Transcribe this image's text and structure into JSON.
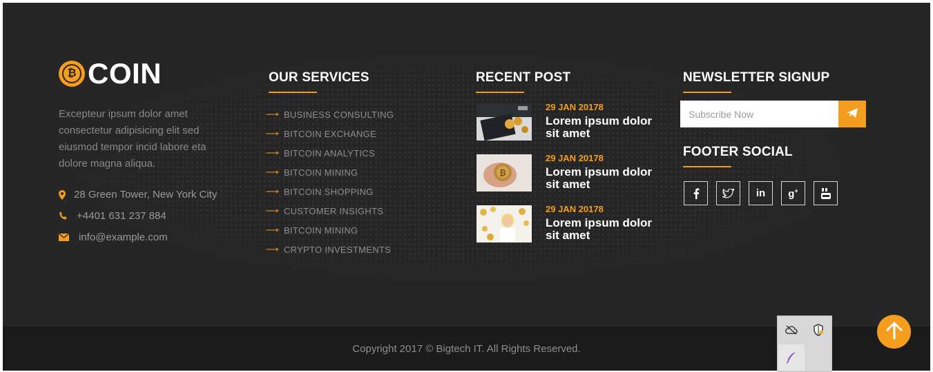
{
  "brand": {
    "logo_letter": "₿",
    "logo_text": "COIN",
    "about": "Excepteur ipsum dolor amet consectetur adipisicing elit sed eiusmod tempor incid labore eta dolore magna aliqua.",
    "contacts": [
      {
        "icon": "map-marker-icon",
        "text": "28 Green Tower, New York City"
      },
      {
        "icon": "phone-icon",
        "text": "+4401 631 237 884"
      },
      {
        "icon": "envelope-icon",
        "text": "info@example.com"
      }
    ]
  },
  "services": {
    "heading": "OUR SERVICES",
    "items": [
      "BUSINESS CONSULTING",
      "BITCOIN EXCHANGE",
      "BITCOIN ANALYTICS",
      "BITCOIN MINING",
      "BITCOIN SHOPPING",
      "CUSTOMER INSIGHTS",
      "BITCOIN MINING",
      "CRYPTO INVESTMENTS"
    ]
  },
  "recent_post": {
    "heading": "RECENT POST",
    "posts": [
      {
        "date": "29 JAN 20178",
        "title": "Lorem ipsum dolor sit amet"
      },
      {
        "date": "29 JAN 20178",
        "title": "Lorem ipsum dolor sit amet"
      },
      {
        "date": "29 JAN 20178",
        "title": "Lorem ipsum dolor sit amet"
      }
    ]
  },
  "newsletter": {
    "heading": "NEWSLETTER SIGNUP",
    "placeholder": "Subscribe Now",
    "button_icon": "paper-plane-icon"
  },
  "social": {
    "heading": "FOOTER SOCIAL",
    "items": [
      {
        "icon": "facebook-icon",
        "glyph": "f"
      },
      {
        "icon": "twitter-icon",
        "glyph": "🐦"
      },
      {
        "icon": "linkedin-icon",
        "glyph": "in"
      },
      {
        "icon": "google-plus-icon",
        "glyph": "g+"
      },
      {
        "icon": "youtube-icon",
        "glyph": "▶"
      }
    ]
  },
  "copyright": "Copyright 2017 © Bigtech IT. All Rights Reserved.",
  "colors": {
    "accent": "#f59d1e",
    "footer_bg": "#262626",
    "bottom_bar": "#1b1b1b"
  }
}
